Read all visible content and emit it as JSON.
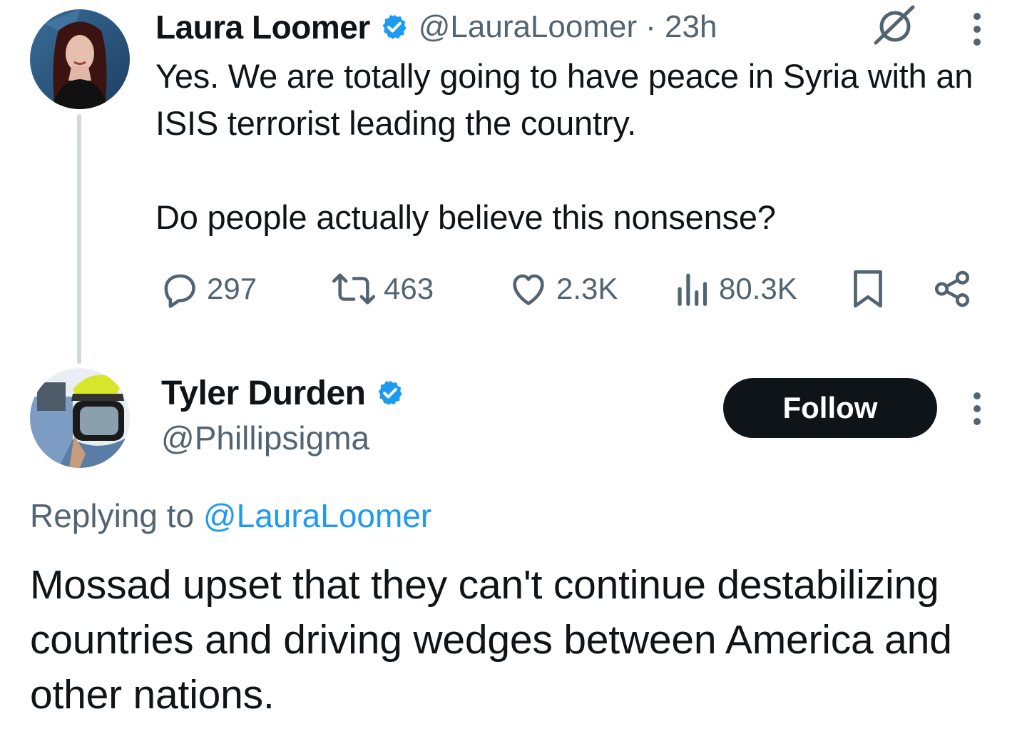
{
  "tweet": {
    "author_name": "Laura Loomer",
    "handle": "@LauraLoomer",
    "time": "· 23h",
    "body": "Yes. We are totally going to have peace in Syria with an ISIS terrorist leading the country.\n\nDo people actually believe this nonsense?",
    "replies": "297",
    "reposts": "463",
    "likes": "2.3K",
    "views": "80.3K"
  },
  "reply": {
    "author_name": "Tyler Durden",
    "handle": "@Phillipsigma",
    "follow_label": "Follow",
    "replying_prefix": "Replying to",
    "replying_mention": "@LauraLoomer",
    "body": "Mossad upset that they can't continue destabilizing countries and driving wedges between America and other nations."
  },
  "colors": {
    "text": "#0f1419",
    "muted": "#536471",
    "accent": "#1d9bf0",
    "thread_line": "#cfd9de"
  },
  "icons": {
    "verified": "verified-badge-icon",
    "grok": "grok-icon",
    "more": "more-vertical-icon",
    "reply": "reply-bubble-icon",
    "repost": "repost-icon",
    "like": "heart-icon",
    "views": "views-bars-icon",
    "bookmark": "bookmark-icon",
    "share": "share-icon"
  }
}
